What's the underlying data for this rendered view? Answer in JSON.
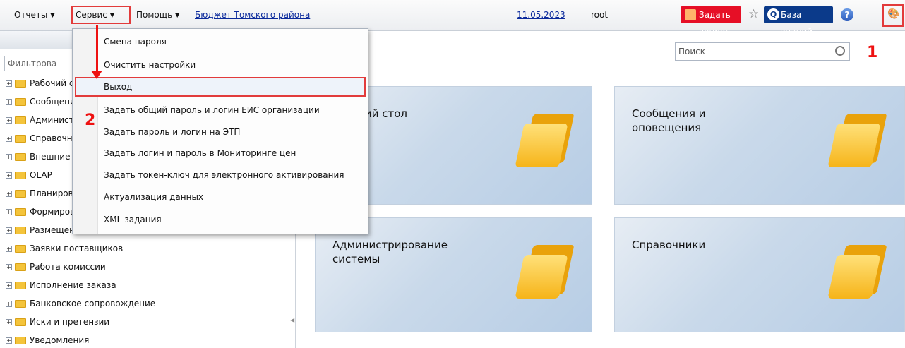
{
  "menubar": {
    "reports": "Отчеты",
    "service": "Сервис",
    "help": "Помощь",
    "budget_link": "Бюджет Томского района",
    "date": "11.05.2023",
    "user": "root",
    "ask_question": "Задать вопрос",
    "knowledge_base": "База знаний"
  },
  "service_menu": {
    "items": [
      "Смена пароля",
      "Очистить настройки",
      "Выход",
      "Задать общий пароль и логин ЕИС организации",
      "Задать пароль и логин на ЭТП",
      "Задать логин и пароль в Мониторинге цен",
      "Задать токен-ключ для электронного активирования",
      "Актуализация данных",
      "XML-задания"
    ]
  },
  "annotations": {
    "one": "1",
    "two": "2"
  },
  "left_panel": {
    "filter_placeholder": "Фильтрова",
    "tree": [
      "Рабочий стол",
      "Сообщения и оповещения",
      "Администрирование системы",
      "Справочники",
      "Внешние",
      "OLAP",
      "Планирование",
      "Формирование",
      "Размещение заказа",
      "Заявки поставщиков",
      "Работа комиссии",
      "Исполнение заказа",
      "Банковское сопровождение",
      "Иски и претензии",
      "Уведомления"
    ]
  },
  "main": {
    "search_placeholder": "Поиск",
    "tiles": [
      "ий стол",
      "Сообщения и оповещения",
      "Администрирование системы",
      "Справочники"
    ]
  }
}
